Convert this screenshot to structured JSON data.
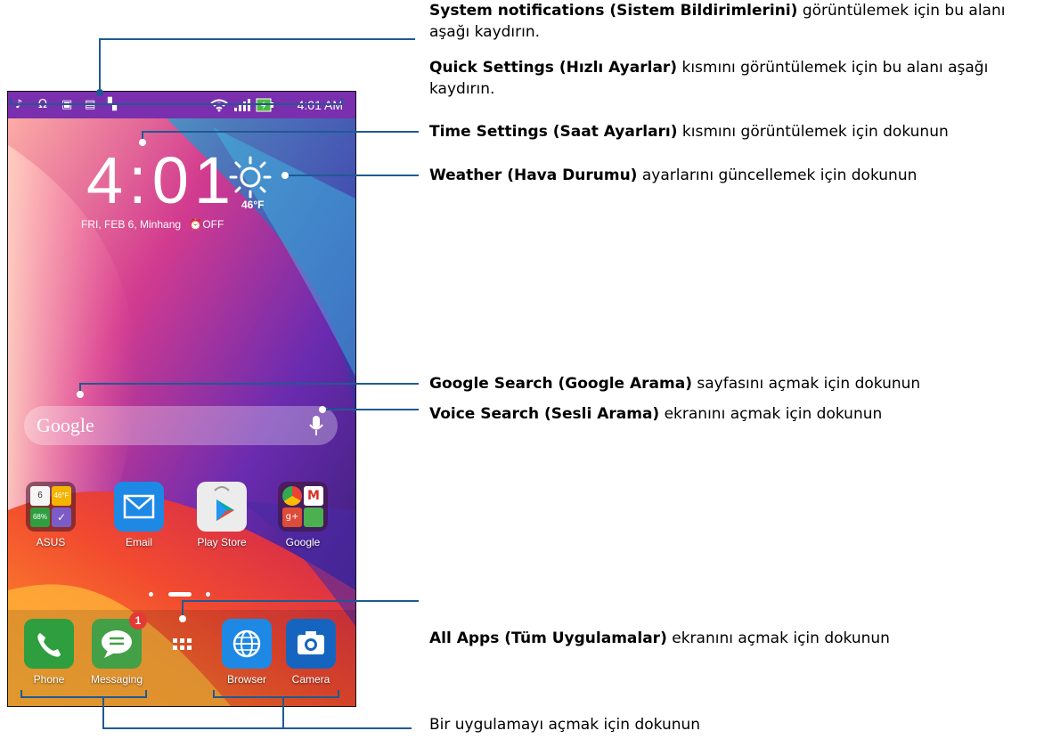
{
  "colors": {
    "callout_line": "#1f5a93",
    "status_bar": "#7a2fae",
    "badge": "#e53935"
  },
  "status_bar": {
    "time": "4:01 AM",
    "left_icons": [
      "music-icon",
      "headphones-icon",
      "image-icon",
      "chat-icon",
      "sd-card-icon"
    ],
    "right_icons": [
      "wifi-icon",
      "signal-icon",
      "battery-charging-icon"
    ]
  },
  "clock_widget": {
    "time": "4:01",
    "temperature": "46°F",
    "date_location": "FRI, FEB 6, Minhang",
    "alarm": "OFF"
  },
  "search_bar": {
    "logo": "Google"
  },
  "apps": [
    {
      "label": "ASUS"
    },
    {
      "label": "Email"
    },
    {
      "label": "Play Store"
    },
    {
      "label": "Google"
    }
  ],
  "asus_folder": {
    "tile1": "6",
    "tile2": "46°F",
    "tile3": "68%"
  },
  "dock": [
    {
      "label": "Phone"
    },
    {
      "label": "Messaging",
      "badge": "1"
    },
    {
      "label": "Browser"
    },
    {
      "label": "Camera"
    }
  ],
  "annotations": {
    "system_notifications": {
      "bold": "System notifications (Sistem Bildirimlerini)",
      "text": " görüntülemek için bu alanı aşağı kaydırın."
    },
    "quick_settings": {
      "bold": "Quick Settings (Hızlı Ayarlar)",
      "text": " kısmını görüntülemek için bu alanı aşağı kaydırın."
    },
    "time_settings": {
      "bold": "Time Settings (Saat Ayarları)",
      "text": " kısmını görüntülemek için dokunun"
    },
    "weather": {
      "bold": "Weather (Hava Durumu)",
      "text": " ayarlarını güncellemek için dokunun"
    },
    "google_search": {
      "bold": "Google Search (Google Arama)",
      "text": " sayfasını açmak için dokunun"
    },
    "voice_search": {
      "bold": "Voice Search (Sesli Arama)",
      "text": " ekranını açmak için dokunun"
    },
    "all_apps": {
      "bold": "All Apps (Tüm Uygulamalar)",
      "text": " ekranını açmak için dokunun"
    },
    "open_app": {
      "text": "Bir uygulamayı açmak için dokunun"
    }
  }
}
